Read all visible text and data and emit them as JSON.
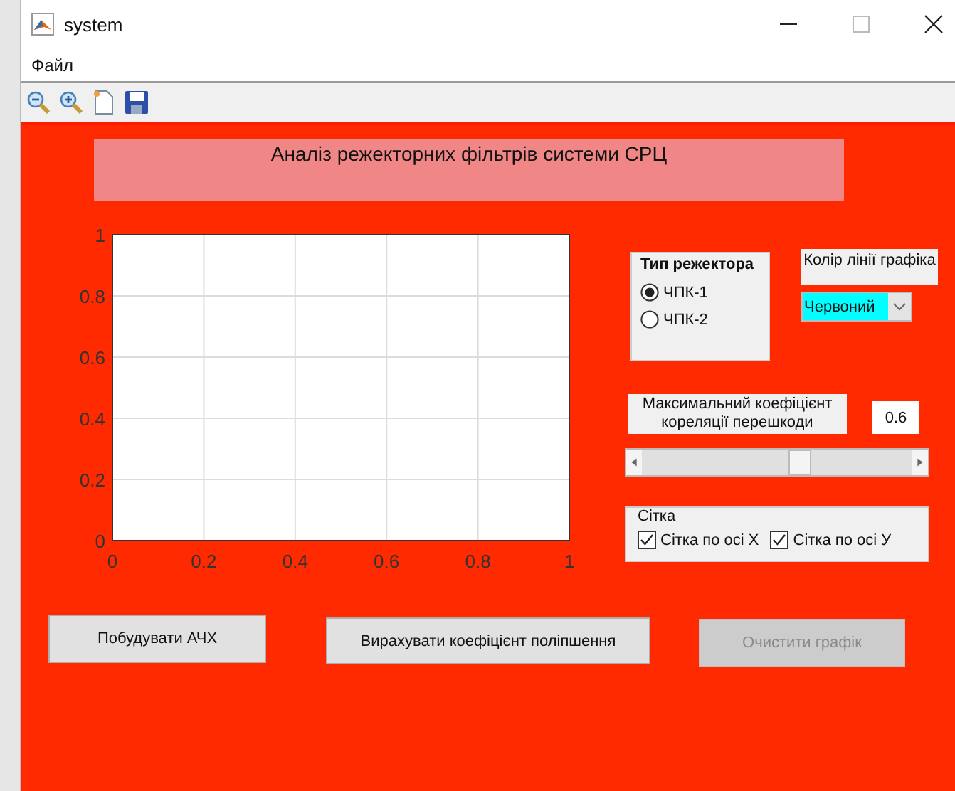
{
  "window": {
    "title": "system"
  },
  "menu": [
    {
      "label": "Файл"
    }
  ],
  "toolbar": [
    {
      "kind": "zoom-out"
    },
    {
      "kind": "zoom-in"
    },
    {
      "kind": "new"
    },
    {
      "kind": "save"
    }
  ],
  "heading": "Аналіз режекторних фільтрів системи СРЦ",
  "chart_data": {
    "type": "line",
    "grid": true,
    "xlim": [
      0,
      1
    ],
    "ylim": [
      0,
      1
    ],
    "xticks": [
      {
        "value": 0,
        "label": "0"
      },
      {
        "value": 0.2,
        "label": "0.2"
      },
      {
        "value": 0.4,
        "label": "0.4"
      },
      {
        "value": 0.6,
        "label": "0.6"
      },
      {
        "value": 0.8,
        "label": "0.8"
      },
      {
        "value": 1,
        "label": "1"
      }
    ],
    "yticks": [
      {
        "value": 0,
        "label": "0"
      },
      {
        "value": 0.2,
        "label": "0.2"
      },
      {
        "value": 0.4,
        "label": "0.4"
      },
      {
        "value": 0.6,
        "label": "0.6"
      },
      {
        "value": 0.8,
        "label": "0.8"
      },
      {
        "value": 1,
        "label": "1"
      }
    ]
  },
  "filter_type": {
    "title": "Тип режектора",
    "options": [
      {
        "label": "ЧПК-1",
        "selected": true
      },
      {
        "label": "ЧПК-2",
        "selected": false
      }
    ]
  },
  "line_color": {
    "label": "Колір лінії графіка",
    "value": "Червоний"
  },
  "correlation": {
    "label": "Максимальний коефіцієнт кореляції перешкоди",
    "value": "0.6",
    "level": 0.6
  },
  "grid": {
    "title": "Сітка",
    "options": [
      {
        "label": "Сітка по осі Х",
        "checked": true
      },
      {
        "label": "Сітка по осі У",
        "checked": true
      }
    ]
  },
  "buttons": [
    {
      "label": "Побудувати АЧХ",
      "disabled": false
    },
    {
      "label": "Вирахувати коефіцієнт поліпшення",
      "disabled": false
    },
    {
      "label": "Очистити графік",
      "disabled": true
    }
  ]
}
